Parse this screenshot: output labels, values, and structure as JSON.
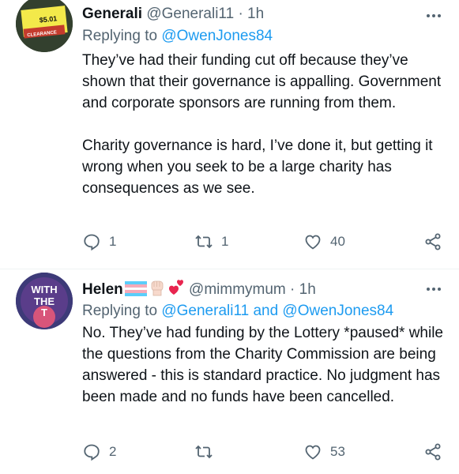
{
  "tweets": [
    {
      "display_name": "Generali",
      "handle": "@Generali11",
      "separator": "·",
      "time": "1h",
      "replying_prefix": "Replying to",
      "replying_to": "@OwenJones84",
      "text": "They’ve had their funding cut off because they’ve shown that their governance is appalling. Government and corporate sponsors are running from them.\n\nCharity governance is hard, I’ve done it, but getting it wrong when you seek to be a large charity has consequences as we see.",
      "avatar": {
        "price_label": "$5.01",
        "sticker_label": "CLEARANCE"
      },
      "counts": {
        "reply": "1",
        "retweet": "1",
        "like": "40"
      }
    },
    {
      "display_name": "Helen",
      "handle": "@mimmymum",
      "separator": "·",
      "time": "1h",
      "replying_prefix": "Replying to",
      "replying_to": "@Generali11 and @OwenJones84",
      "text": "No. They’ve had funding by the Lottery *paused* while the questions from the Charity Commission are being answered - this is standard practice. No judgment has been made and no funds have been cancelled.",
      "avatar": {
        "line1": "WITH",
        "line2": "THE",
        "line3": "T"
      },
      "counts": {
        "reply": "2",
        "retweet": "",
        "like": "53"
      }
    }
  ],
  "icons": {
    "more": "more-horizontal-icon",
    "reply": "reply-icon",
    "retweet": "retweet-icon",
    "like": "heart-icon",
    "share": "share-icon"
  },
  "colors": {
    "link": "#1d9bf0",
    "secondary_text": "#536471",
    "text": "#0f1419"
  }
}
